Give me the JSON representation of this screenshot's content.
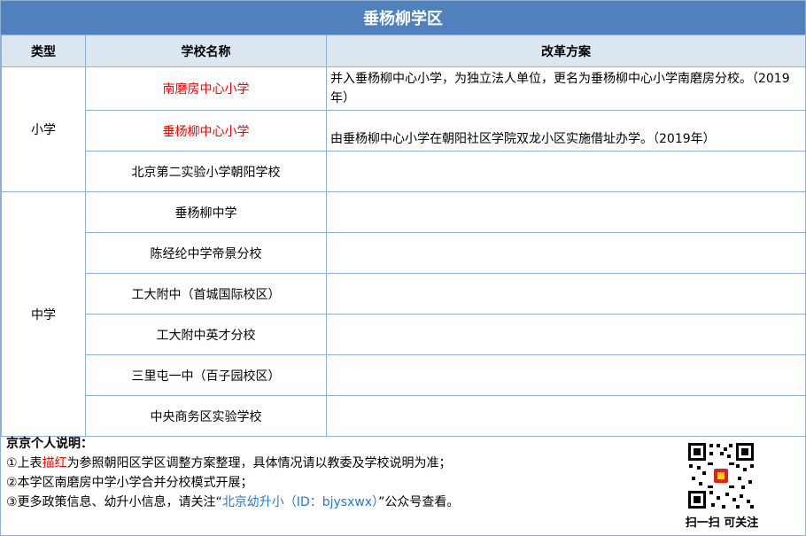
{
  "title": "垂杨柳学区",
  "table": {
    "headers": [
      "类型",
      "学校名称",
      "改革方案"
    ],
    "groups": [
      {
        "type": "小学",
        "rows": [
          {
            "school": "南磨房中心小学",
            "highlight": true,
            "plan": "并入垂杨柳中心小学，为独立法人单位，更名为垂杨柳中心小学南磨房分校。（2019年）"
          },
          {
            "school": "垂杨柳中心小学",
            "highlight": true,
            "plan": "由垂杨柳中心小学在朝阳社区学院双龙小区实施借址办学。（2019年）"
          },
          {
            "school": "北京第二实验小学朝阳学校",
            "highlight": false,
            "plan": ""
          }
        ]
      },
      {
        "type": "中学",
        "rows": [
          {
            "school": "垂杨柳中学",
            "highlight": false,
            "plan": ""
          },
          {
            "school": "陈经纶中学帝景分校",
            "highlight": false,
            "plan": ""
          },
          {
            "school": "工大附中（首城国际校区）",
            "highlight": false,
            "plan": ""
          },
          {
            "school": "工大附中英才分校",
            "highlight": false,
            "plan": ""
          },
          {
            "school": "三里屯一中（百子园校区）",
            "highlight": false,
            "plan": ""
          },
          {
            "school": "中央商务区实验学校",
            "highlight": false,
            "plan": ""
          }
        ]
      }
    ]
  },
  "notes": {
    "heading": "京京个人说明：",
    "line1_pre": "①上表",
    "line1_red": "描红",
    "line1_post": "为参照朝阳区学区调整方案整理，具体情况请以教委及学校说明为准；",
    "line2": "②本学区南磨房中学小学合并分校模式开展；",
    "line3_pre": "③更多政策信息、幼升小信息，请关注“",
    "line3_blue": "北京幼升小（ID：bjysxwx）",
    "line3_post": "”公众号查看。"
  },
  "qr_caption": "扫一扫 可关注",
  "colors": {
    "header_bg": "#4f81bd",
    "subheader_bg": "#dce6f1",
    "highlight": "#ff0000",
    "link": "#1f7ad8"
  }
}
